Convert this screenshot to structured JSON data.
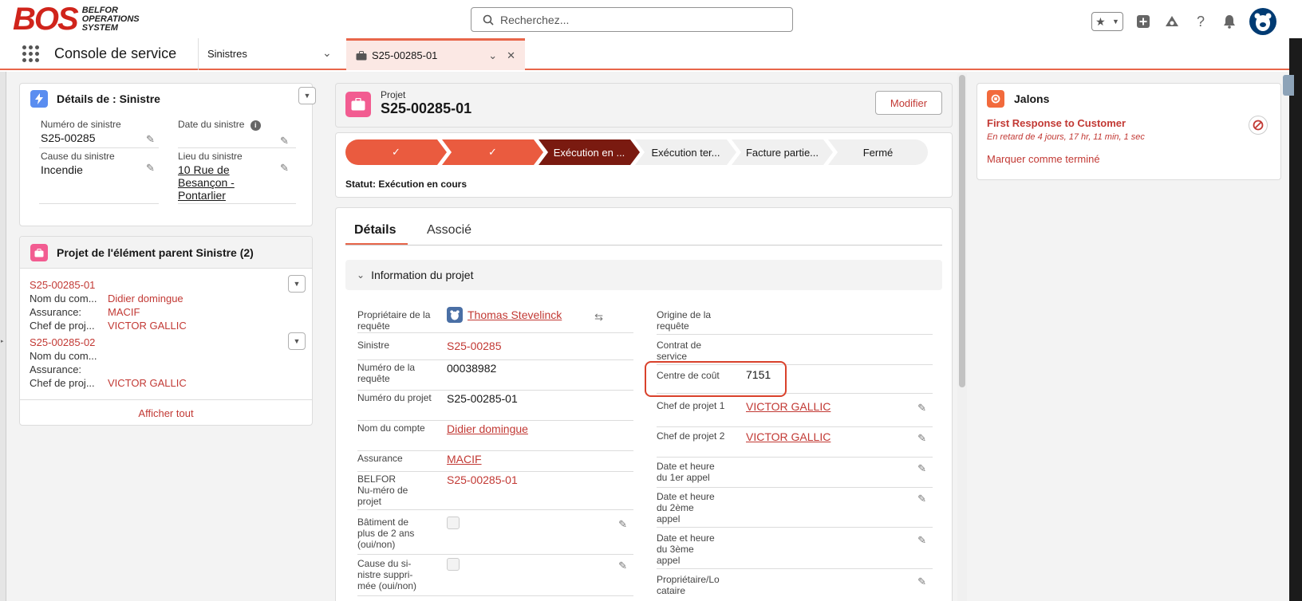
{
  "header": {
    "logo_mark": "BOS",
    "logo_line1": "BELFOR",
    "logo_line2": "OPERATIONS",
    "logo_line3": "SYSTEM",
    "search_placeholder": "Recherchez..."
  },
  "nav": {
    "app_name": "Console de service",
    "object_tab": "Sinistres",
    "active_tab": "S25-00285-01"
  },
  "claim_details": {
    "title": "Détails de : Sinistre",
    "fields": {
      "claim_number_label": "Numéro de sinistre",
      "claim_number": "S25-00285",
      "claim_date_label": "Date du sinistre",
      "cause_label": "Cause du sinistre",
      "cause": "Incendie",
      "location_label": "Lieu du sinistre",
      "location_line1": "10 Rue de",
      "location_line2": "Besançon -",
      "location_line3": "Pontarlier"
    }
  },
  "related_projects": {
    "title": "Projet de l'élément parent Sinistre (2)",
    "items": [
      {
        "id": "S25-00285-01",
        "account_label": "Nom du com...",
        "account": "Didier domingue",
        "insurance_label": "Assurance:",
        "insurance": "MACIF",
        "pm_label": "Chef de proj...",
        "pm": "VICTOR GALLIC"
      },
      {
        "id": "S25-00285-02",
        "account_label": "Nom du com...",
        "account": "",
        "insurance_label": "Assurance:",
        "insurance": "",
        "pm_label": "Chef de proj...",
        "pm": "VICTOR GALLIC"
      }
    ],
    "view_all": "Afficher tout"
  },
  "record": {
    "object_label": "Projet",
    "name": "S25-00285-01",
    "edit_button": "Modifier",
    "path": {
      "stages": [
        "Exécution en ...",
        "Exécution ter...",
        "Facture partie...",
        "Fermé"
      ],
      "done_mark": "✓",
      "status_text": "Statut: Exécution en cours"
    },
    "tabs": [
      "Détails",
      "Associé"
    ],
    "section_title": "Information du projet",
    "left_fields": [
      {
        "label": "Propriétaire de la requête",
        "value": "Thomas Stevelinck"
      },
      {
        "label": "Sinistre",
        "value": "S25-00285"
      },
      {
        "label": "Numéro de la requête",
        "value": "00038982"
      },
      {
        "label": "Numéro du projet",
        "value": "S25-00285-01"
      },
      {
        "label": "Nom du compte",
        "value": "Didier domingue"
      },
      {
        "label": "Assurance",
        "value": "MACIF"
      },
      {
        "label": "BELFOR Nu-méro de projet",
        "value": "S25-00285-01"
      },
      {
        "label": "Bâtiment de plus de 2 ans (oui/non)",
        "value": ""
      },
      {
        "label": "Cause du si-nistre suppri-mée (oui/non)",
        "value": ""
      }
    ],
    "right_fields": [
      {
        "label": "Origine de la requête",
        "value": ""
      },
      {
        "label": "Contrat de service",
        "value": ""
      },
      {
        "label": "Centre de coût",
        "value": "7151"
      },
      {
        "label": "Chef de projet 1",
        "value": "VICTOR GALLIC"
      },
      {
        "label": "Chef de projet 2",
        "value": "VICTOR GALLIC"
      },
      {
        "label": "Date et heure du 1er appel",
        "value": ""
      },
      {
        "label": "Date et heure du 2ème appel",
        "value": ""
      },
      {
        "label": "Date et heure du 3ème appel",
        "value": ""
      },
      {
        "label": "Propriétaire/Lo cataire",
        "value": ""
      }
    ]
  },
  "milestones": {
    "title": "Jalons",
    "name": "First Response to Customer",
    "overdue": "En retard de 4 jours, 17 hr, 11 min, 1 sec",
    "mark_done": "Marquer comme terminé"
  },
  "colors": {
    "brand_red": "#d0241b",
    "link_red": "#c23934",
    "path_done": "#ea5b3f",
    "path_current": "#7a1a10",
    "highlight": "#d9412b"
  }
}
